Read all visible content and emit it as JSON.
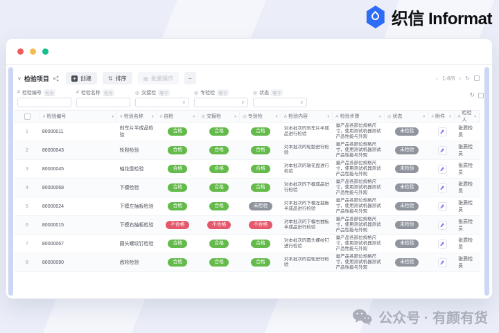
{
  "brand": {
    "name": "织信 Informat"
  },
  "window": {
    "toolbar": {
      "title": "检验项目",
      "create_label": "创建",
      "sort_label": "排序",
      "batch_label": "批量操作",
      "more_label": "–",
      "pagination": "1-8/8"
    },
    "filters": [
      {
        "label": "检验编号",
        "op": "包含",
        "type": "text",
        "icon": "#"
      },
      {
        "label": "检验名称",
        "op": "包含",
        "type": "text",
        "icon": "#"
      },
      {
        "label": "交接检",
        "op": "等于",
        "type": "select",
        "icon": "◎"
      },
      {
        "label": "专验检",
        "op": "等于",
        "type": "select",
        "icon": "◎"
      },
      {
        "label": "状态",
        "op": "等于",
        "type": "select",
        "icon": "◎"
      }
    ],
    "table": {
      "columns": [
        {
          "icon": "#",
          "label": "检验编号"
        },
        {
          "icon": "#",
          "label": "检验名称"
        },
        {
          "icon": "#",
          "label": "自检"
        },
        {
          "icon": "◎",
          "label": "交接检"
        },
        {
          "icon": "◎",
          "label": "专验检"
        },
        {
          "icon": "A",
          "label": "检验内容"
        },
        {
          "icon": "A",
          "label": "检验步骤"
        },
        {
          "icon": "◎",
          "label": "状态"
        },
        {
          "icon": "#",
          "label": "附件"
        },
        {
          "icon": "A",
          "label": "检验人"
        }
      ],
      "rows": [
        {
          "num": "1",
          "id": "80000011",
          "name": "刹车片半成品检验",
          "self": "合格",
          "handover": "合格",
          "special": "合格",
          "content": "对本批次的刹车片半成品进行检验",
          "steps": "量产品各部位规格尺寸，使用测试机器测试产品性能与外观",
          "status": "未检验",
          "inspector": "张质检员"
        },
        {
          "num": "2",
          "id": "80000043",
          "name": "轮毂检验",
          "self": "合格",
          "handover": "合格",
          "special": "合格",
          "content": "对本批次的轮毂进行检验",
          "steps": "量产品各部位规格尺寸，使用测试机器测试产品性能与外观",
          "status": "未检验",
          "inspector": "张质检员"
        },
        {
          "num": "3",
          "id": "80000045",
          "name": "轴花盘检验",
          "self": "合格",
          "handover": "合格",
          "special": "合格",
          "content": "对本批次的轴花盘进行检验",
          "steps": "量产品各部位规格尺寸，使用测试机器测试产品性能与外观",
          "status": "未检验",
          "inspector": "张质检员"
        },
        {
          "num": "4",
          "id": "80000068",
          "name": "下模检验",
          "self": "合格",
          "handover": "合格",
          "special": "合格",
          "content": "对本批次的下模成品进行检验",
          "steps": "量产品各部位规格尺寸，使用测试机器测试产品性能与外观",
          "status": "未检验",
          "inspector": "张质检员"
        },
        {
          "num": "5",
          "id": "80000024",
          "name": "下模左抽板检验",
          "self": "合格",
          "handover": "合格",
          "special": "未检验",
          "content": "对本批次的下模左抽板半成品进行检验",
          "steps": "量产品各部位规格尺寸，使用测试机器测试产品性能与外观",
          "status": "未检验",
          "inspector": "张质检员"
        },
        {
          "num": "6",
          "id": "80000015",
          "name": "下模右抽板检验",
          "self": "不合格",
          "handover": "不合格",
          "special": "不合格",
          "content": "对本批次的下模右抽板半成品进行检验",
          "steps": "量产品各部位规格尺寸，使用测试机器测试产品性能与外观",
          "status": "未检验",
          "inspector": "张质检员"
        },
        {
          "num": "7",
          "id": "80000067",
          "name": "圆头螺纹钉检验",
          "self": "合格",
          "handover": "合格",
          "special": "合格",
          "content": "对本批次的圆头螺纹钉进行检验",
          "steps": "量产品各部位规格尺寸，使用测试机器测试产品性能与外观",
          "status": "未检验",
          "inspector": "张质检员"
        },
        {
          "num": "8",
          "id": "80000090",
          "name": "齿轮检验",
          "self": "合格",
          "handover": "合格",
          "special": "合格",
          "content": "对本批次的齿轮进行检验",
          "steps": "量产品各部位规格尺寸，使用测试机器测试产品性能与外观",
          "status": "未检验",
          "inspector": "张质检员"
        }
      ]
    }
  },
  "status_colors": {
    "合格": "#64ba4a",
    "不合格": "#e5586c",
    "未检验": "#8f949d"
  },
  "titlebar_colors": {
    "close": "#f25d58",
    "minimize": "#f5bd4f",
    "maximize": "#17bf8f"
  },
  "watermark": {
    "text": "公众号 · 有颜有货"
  }
}
